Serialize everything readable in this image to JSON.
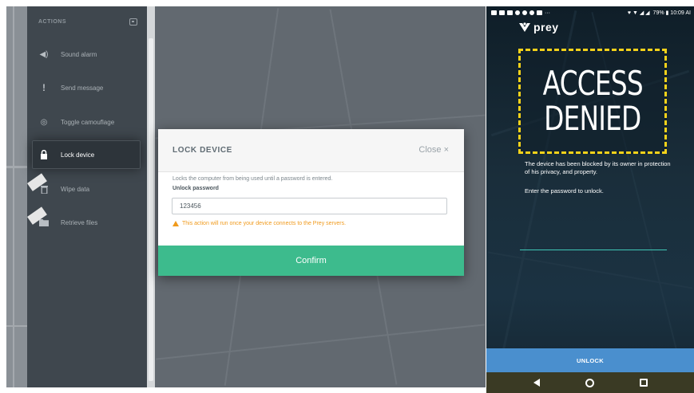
{
  "sidebar": {
    "title": "ACTIONS",
    "items": [
      {
        "label": "Sound alarm",
        "icon": "speaker-icon"
      },
      {
        "label": "Send message",
        "icon": "exclamation-icon"
      },
      {
        "label": "Toggle camouflage",
        "icon": "eye-slash-icon"
      },
      {
        "label": "Lock device",
        "icon": "lock-icon",
        "active": true
      },
      {
        "label": "Wipe data",
        "icon": "trash-icon"
      },
      {
        "label": "Retrieve files",
        "icon": "folder-icon"
      }
    ]
  },
  "modal": {
    "title": "LOCK DEVICE",
    "close_label": "Close ×",
    "description": "Locks the computer from being used until a password is entered.",
    "password_label": "Unlock password",
    "password_value": "123456",
    "warning": "This action will run once your device connects to the Prey servers.",
    "confirm_label": "Confirm"
  },
  "phone": {
    "status_time": "79% ▮ 10:09 AI",
    "logo_text": "prey",
    "denied_line1": "ACCESS",
    "denied_line2": "DENIED",
    "blocked_message": "The device has been blocked by its owner in protection of his privacy, and property.",
    "enter_message": "Enter the password to unlock.",
    "unlock_label": "UNLOCK"
  },
  "colors": {
    "confirm_green": "#3dbb8d",
    "warning_orange": "#f09a1c",
    "denied_yellow": "#f5d21a",
    "unlock_blue": "#4a8fce"
  }
}
